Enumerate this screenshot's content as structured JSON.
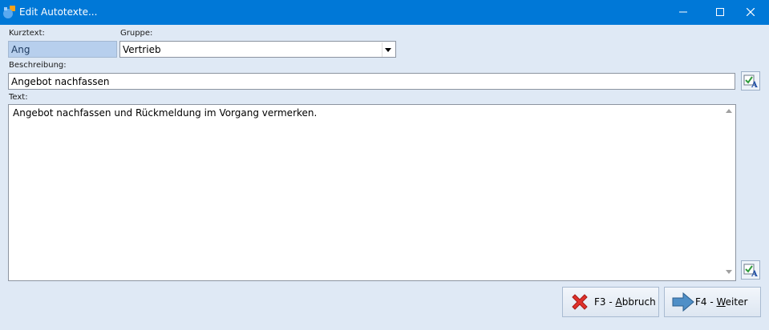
{
  "window": {
    "title": "Edit Autotexte...",
    "icons": {
      "app": "app-icon",
      "minimize": "minimize-icon",
      "maximize": "maximize-icon",
      "close": "close-icon"
    }
  },
  "form": {
    "kurztext": {
      "label": "Kurztext:",
      "value": "Ang"
    },
    "gruppe": {
      "label": "Gruppe:",
      "value": "Vertrieb"
    },
    "beschreibung": {
      "label": "Beschreibung:",
      "value": "Angebot nachfassen"
    },
    "text": {
      "label": "Text:",
      "value": "Angebot nachfassen und Rückmeldung im Vorgang vermerken."
    }
  },
  "buttons": {
    "abbruch": {
      "prefix": "F3 - ",
      "accel": "A",
      "rest": "bbruch"
    },
    "weiter": {
      "prefix": "F4 - ",
      "accel": "W",
      "rest": "eiter"
    }
  },
  "colors": {
    "titlebar": "#0078d7",
    "background": "#dfe9f5",
    "kurztext_selection": "#b7cfed"
  }
}
